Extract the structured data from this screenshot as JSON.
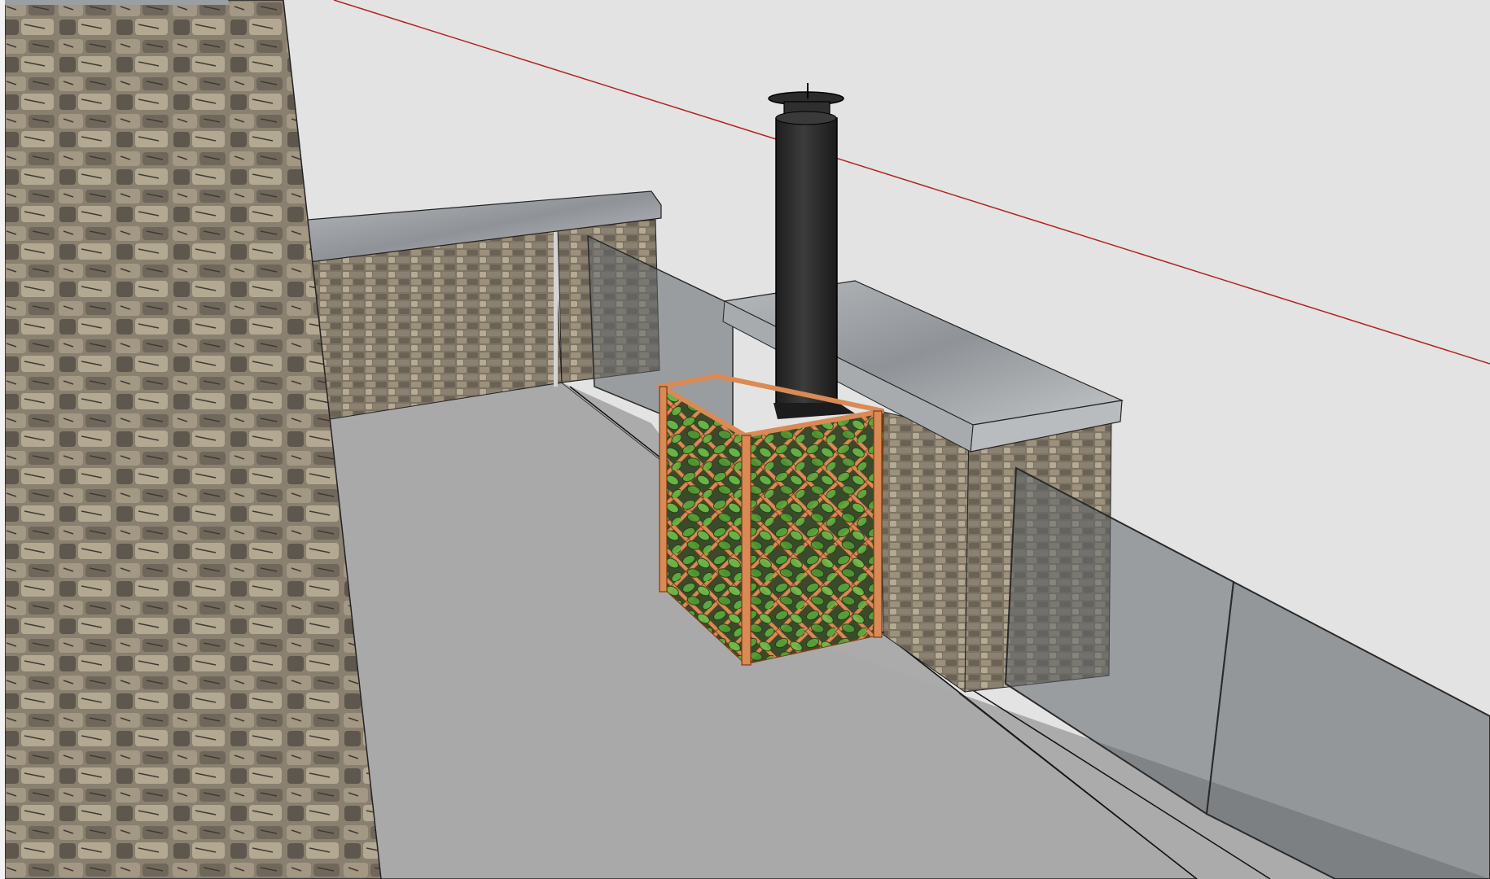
{
  "viewport": {
    "label": "",
    "background": "#e3e3e3",
    "axis_color": "#b22222"
  },
  "materials": {
    "stone_wall": "#8c8273",
    "stone_dark": "#5e574d",
    "stone_light": "#c2b8a3",
    "coping": "#9a9ea1",
    "coping_light": "#c9cccf",
    "floor": "#a8a8a8",
    "flue": "#2b2b2b",
    "flue_highlight": "#4a4a4a",
    "trellis_wood": "#d98a55",
    "trellis_edge": "#7a3a14",
    "leaf": "#5aa83c",
    "leaf_dark": "#2f6a1e",
    "glass": "rgba(120,125,128,0.55)",
    "glass_edge": "#2a2a2a"
  }
}
